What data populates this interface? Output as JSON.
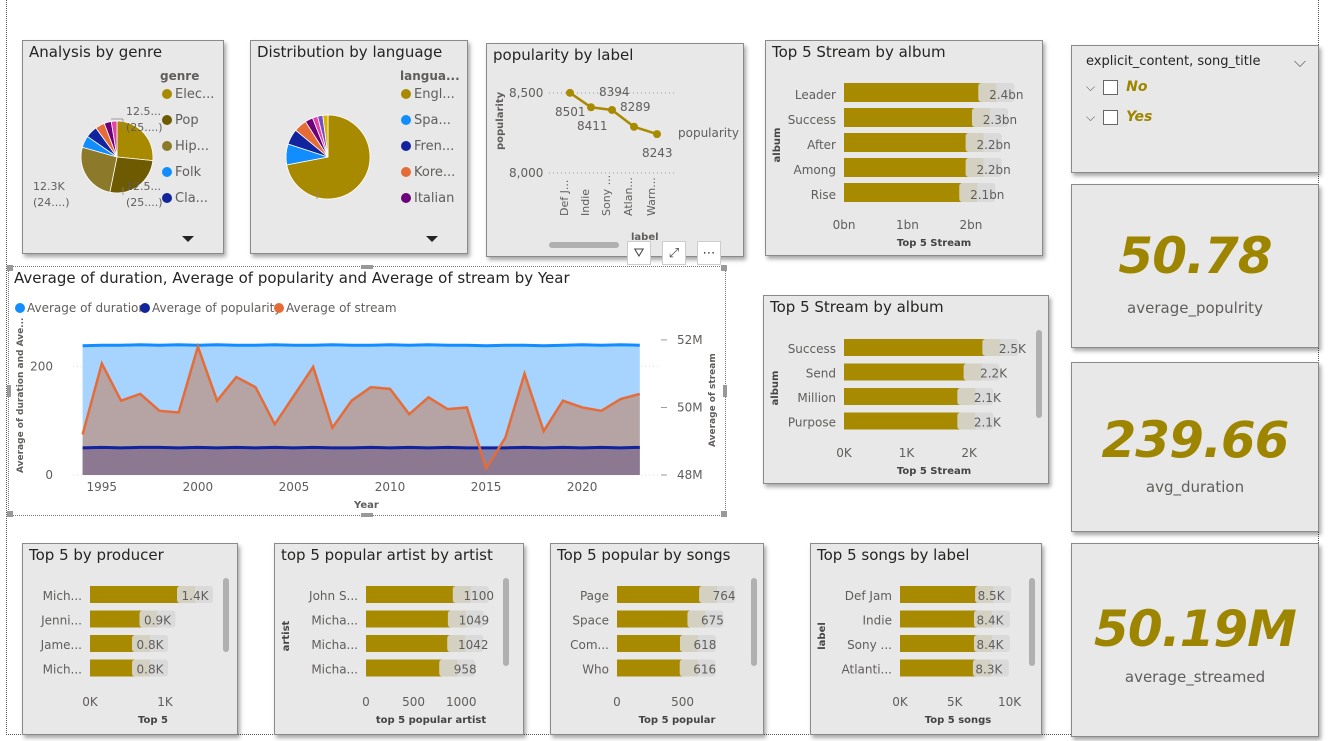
{
  "colors": {
    "gold": "#a88a00",
    "blue": "#118dff",
    "navy": "#12239e",
    "orange": "#e66c37",
    "purple": "#6b007b",
    "olive": "#7a6a00"
  },
  "genre_pie": {
    "title": "Analysis by genre",
    "legend_title": "genre",
    "legend": [
      "Elec...",
      "Pop",
      "Hip...",
      "Folk",
      "Cla..."
    ],
    "label_right_top": [
      "12.5...",
      "(25....)"
    ],
    "label_right_bottom": [
      "12.5...",
      "(25....)"
    ],
    "label_left": [
      "12.3K",
      "(24....)"
    ]
  },
  "language_pie": {
    "title": "Distribution by language",
    "legend_title": "langua...",
    "legend": [
      "Engl...",
      "Spa...",
      "Fren...",
      "Kore...",
      "Italian"
    ]
  },
  "label_line": {
    "title": "popularity by label",
    "ylabel": "popularity",
    "xlabel": "label",
    "yticks": [
      "8,500",
      "8,000"
    ],
    "legend": "popularity",
    "categories": [
      "Def J...",
      "Indie",
      "Sony ...",
      "Atlan...",
      "Warn..."
    ],
    "values": [
      8501,
      8411,
      8394,
      8289,
      8243
    ],
    "value_labels": [
      "8501",
      "8411",
      "8394",
      "8289",
      "8243"
    ]
  },
  "stream_album1": {
    "title": "Top 5 Stream by album",
    "ylabel": "album",
    "xlabel": "Top 5 Stream",
    "categories": [
      "Leader",
      "Success",
      "After",
      "Among",
      "Rise"
    ],
    "values": [
      2.4,
      2.3,
      2.2,
      2.2,
      2.1
    ],
    "value_labels": [
      "2.4bn",
      "2.3bn",
      "2.2bn",
      "2.2bn",
      "2.1bn"
    ],
    "xticks": [
      "0bn",
      "1bn",
      "2bn"
    ],
    "xmax": 2.6
  },
  "slicer": {
    "title": "explicit_content, song_title",
    "items": [
      "No",
      "Yes"
    ]
  },
  "kpis": [
    {
      "value": "50.78",
      "label": "average_populrity"
    },
    {
      "value": "239.66",
      "label": "avg_duration"
    },
    {
      "value": "50.19M",
      "label": "average_streamed"
    }
  ],
  "yearly": {
    "title": "Average of duration, Average of popularity and Average of stream by Year",
    "legend": [
      "Average of duration",
      "Average of popularity",
      "Average of stream"
    ],
    "ylabel_left": "Average of duration and Ave...",
    "ylabel_right": "Average of stream",
    "xlabel": "Year",
    "left_ticks": [
      "200",
      "0"
    ],
    "right_ticks": [
      "52M",
      "50M",
      "48M"
    ],
    "x_ticks": [
      "1995",
      "2000",
      "2005",
      "2010",
      "2015",
      "2020"
    ]
  },
  "chart_data": [
    {
      "type": "area",
      "title": "Average of duration, Average of popularity and Average of stream by Year",
      "x": [
        1994,
        1995,
        1996,
        1997,
        1998,
        1999,
        2000,
        2001,
        2002,
        2003,
        2004,
        2005,
        2006,
        2007,
        2008,
        2009,
        2010,
        2011,
        2012,
        2013,
        2014,
        2015,
        2016,
        2017,
        2018,
        2019,
        2020,
        2021,
        2022,
        2023
      ],
      "series": [
        {
          "name": "Average of duration",
          "axis": "left",
          "values": [
            238,
            239,
            239,
            240,
            239,
            240,
            239,
            240,
            239,
            239,
            240,
            239,
            239,
            240,
            239,
            239,
            240,
            239,
            240,
            239,
            239,
            238,
            239,
            239,
            238,
            239,
            240,
            239,
            240,
            239
          ]
        },
        {
          "name": "Average of popularity",
          "axis": "left",
          "values": [
            50,
            51,
            50,
            51,
            51,
            50,
            51,
            50,
            51,
            50,
            51,
            50,
            51,
            50,
            50,
            51,
            50,
            51,
            50,
            51,
            50,
            50,
            50,
            51,
            50,
            51,
            50,
            51,
            50,
            51
          ]
        },
        {
          "name": "Average of stream",
          "axis": "right",
          "values": [
            49.2,
            51.3,
            50.2,
            50.4,
            49.9,
            49.85,
            51.8,
            50.2,
            50.9,
            50.6,
            49.5,
            50.35,
            51.2,
            49.4,
            50.2,
            50.6,
            50.55,
            49.8,
            50.3,
            49.95,
            50.0,
            48.2,
            49.1,
            51.0,
            49.3,
            50.2,
            50.0,
            49.9,
            50.25,
            50.4
          ]
        }
      ],
      "ylim_left": [
        0,
        280
      ],
      "ylim_right": [
        48,
        52.5
      ],
      "xlim": [
        1993.5,
        2024
      ]
    },
    {
      "type": "pie",
      "title": "Analysis by genre",
      "categories": [
        "Elec...",
        "Pop",
        "Hip...",
        "Folk",
        "Cla..."
      ],
      "values": [
        12.5,
        12.5,
        12.3,
        2.5,
        2.5
      ]
    },
    {
      "type": "pie",
      "title": "Distribution by language",
      "categories": [
        "Engl...",
        "Spa...",
        "Fren...",
        "Kore...",
        "Italian"
      ],
      "values": [
        72,
        8,
        6,
        5,
        3
      ]
    }
  ],
  "stream_album2": {
    "title": "Top 5 Stream by album",
    "ylabel": "album",
    "xlabel": "Top 5 Stream",
    "categories": [
      "Success",
      "Send",
      "Million",
      "Purpose"
    ],
    "values": [
      2.5,
      2.2,
      2.1,
      2.1
    ],
    "value_labels": [
      "2.5K",
      "2.2K",
      "2.1K",
      "2.1K"
    ],
    "xticks": [
      "0K",
      "1K",
      "2K"
    ],
    "xmax": 2.75
  },
  "producer": {
    "title": "Top 5 by producer",
    "ylabel": "",
    "xlabel": "Top 5",
    "categories": [
      "Mich...",
      "Jenni...",
      "Jame...",
      "Mich..."
    ],
    "values": [
      1.4,
      0.9,
      0.8,
      0.8
    ],
    "value_labels": [
      "1.4K",
      "0.9K",
      "0.8K",
      "0.8K"
    ],
    "xticks": [
      "0K",
      "1K"
    ],
    "xmax": 1.6
  },
  "artist": {
    "title": "top 5 popular artist by artist",
    "ylabel": "artist",
    "xlabel": "top 5 popular artist",
    "categories": [
      "John S...",
      "Micha...",
      "Micha...",
      "Micha..."
    ],
    "values": [
      1100,
      1049,
      1042,
      958
    ],
    "value_labels": [
      "1100",
      "1049",
      "1042",
      "958"
    ],
    "xticks": [
      "0",
      "500",
      "1000"
    ],
    "xmax": 1260
  },
  "songs": {
    "title": "Top 5 popular by songs",
    "ylabel": "",
    "xlabel": "Top 5 popular",
    "categories": [
      "Page",
      "Space",
      "Com...",
      "Who"
    ],
    "values": [
      764,
      675,
      618,
      616
    ],
    "value_labels": [
      "764",
      "675",
      "618",
      "616"
    ],
    "xticks": [
      "0",
      "500"
    ],
    "xmax": 870
  },
  "label_songs": {
    "title": "Top 5 songs by label",
    "ylabel": "label",
    "xlabel": "Top 5 songs",
    "categories": [
      "Def Jam",
      "Indie",
      "Sony ...",
      "Atlanti..."
    ],
    "values": [
      8.5,
      8.4,
      8.4,
      8.3
    ],
    "value_labels": [
      "8.5K",
      "8.4K",
      "8.4K",
      "8.3K"
    ],
    "xticks": [
      "0K",
      "5K",
      "10K"
    ],
    "xmax": 10.5
  }
}
